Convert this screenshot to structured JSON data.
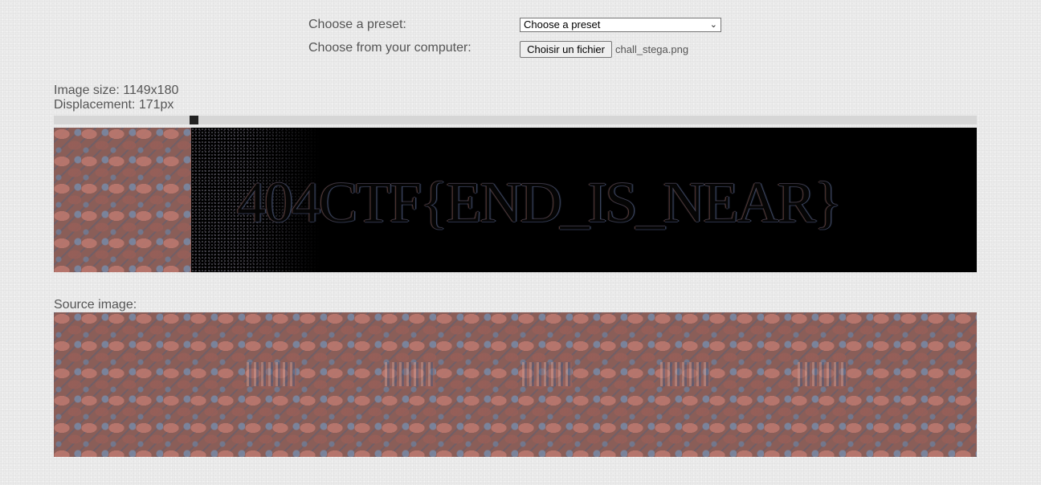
{
  "controls": {
    "preset_label": "Choose a preset:",
    "preset_selected": "Choose a preset",
    "file_label": "Choose from your computer:",
    "file_button": "Choisir un fichier",
    "file_name": "chall_stega.png"
  },
  "info": {
    "image_size": "Image size: 1149x180",
    "displacement": "Displacement: 171px"
  },
  "slider": {
    "value": 171,
    "max": 1149
  },
  "stereogram": {
    "revealed_text": "404CTF{END_IS_NEAR}"
  },
  "source": {
    "label": "Source image:"
  }
}
